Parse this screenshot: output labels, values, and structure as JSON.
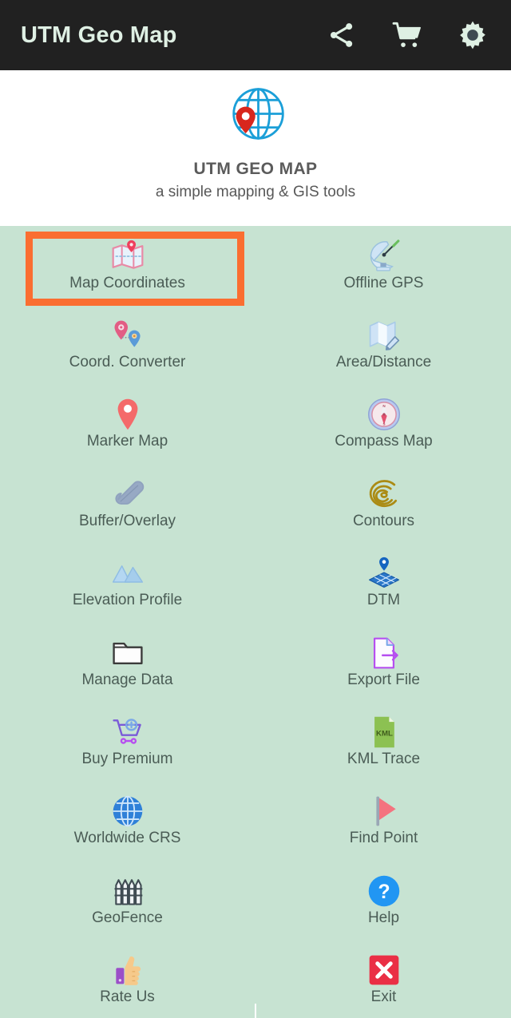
{
  "appbar": {
    "title": "UTM Geo Map",
    "actions": [
      {
        "name": "share-icon",
        "label": "Share"
      },
      {
        "name": "cart-icon",
        "label": "Store"
      },
      {
        "name": "gear-icon",
        "label": "Settings"
      }
    ],
    "background_color": "#212121",
    "title_color": "#dff0e4"
  },
  "brand": {
    "logo_icon": "globe-pin-logo",
    "name": "UTM GEO MAP",
    "tagline": "a simple mapping & GIS tools"
  },
  "grid": {
    "background_color": "#c7e3d2",
    "label_color": "#4a5c55",
    "highlight_color": "#fa6e31",
    "items": [
      {
        "label": "Map Coordinates",
        "icon": "folded-map-pin-icon",
        "highlighted": true
      },
      {
        "label": "Offline GPS",
        "icon": "satellite-dish-icon",
        "highlighted": false
      },
      {
        "label": "Coord. Converter",
        "icon": "two-pins-icon",
        "highlighted": false
      },
      {
        "label": "Area/Distance",
        "icon": "map-pencil-icon",
        "highlighted": false
      },
      {
        "label": "Marker Map",
        "icon": "map-marker-icon",
        "highlighted": false
      },
      {
        "label": "Compass Map",
        "icon": "compass-icon",
        "highlighted": false
      },
      {
        "label": "Buffer/Overlay",
        "icon": "buffer-shape-icon",
        "highlighted": false
      },
      {
        "label": "Contours",
        "icon": "contour-rings-icon",
        "highlighted": false
      },
      {
        "label": "Elevation Profile",
        "icon": "mountains-icon",
        "highlighted": false
      },
      {
        "label": "DTM",
        "icon": "terrain-grid-pin-icon",
        "highlighted": false
      },
      {
        "label": "Manage Data",
        "icon": "folder-icon",
        "highlighted": false
      },
      {
        "label": "Export File",
        "icon": "file-export-icon",
        "highlighted": false
      },
      {
        "label": "Buy Premium",
        "icon": "cart-plus-icon",
        "highlighted": false
      },
      {
        "label": "KML Trace",
        "icon": "kml-file-icon",
        "highlighted": false
      },
      {
        "label": "Worldwide CRS",
        "icon": "globe-icon",
        "highlighted": false
      },
      {
        "label": "Find Point",
        "icon": "flag-icon",
        "highlighted": false
      },
      {
        "label": "GeoFence",
        "icon": "fence-icon",
        "highlighted": false
      },
      {
        "label": "Help",
        "icon": "question-circle-icon",
        "highlighted": false
      },
      {
        "label": "Rate Us",
        "icon": "thumbs-up-icon",
        "highlighted": false
      },
      {
        "label": "Exit",
        "icon": "close-square-icon",
        "highlighted": false
      }
    ]
  }
}
